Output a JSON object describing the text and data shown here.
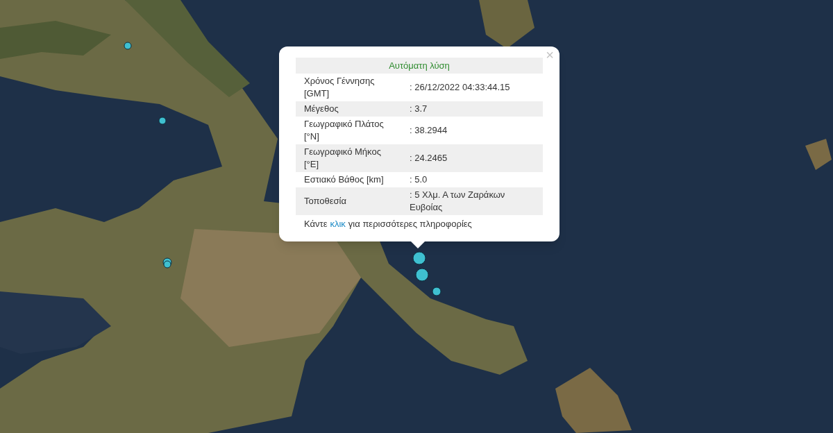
{
  "popup": {
    "title": "Αυτόματη λύση",
    "close": "×",
    "rows": [
      {
        "label": "Χρόνος Γέννησης [GMT]",
        "value": ": 26/12/2022 04:33:44.15"
      },
      {
        "label": "Μέγεθος",
        "value": ": 3.7"
      },
      {
        "label": "Γεωγραφικό Πλάτος [°N]",
        "value": ": 38.2944"
      },
      {
        "label": "Γεωγραφικό Μήκος [°E]",
        "value": ": 24.2465"
      },
      {
        "label": "Εστιακό Βάθος [km]",
        "value": ": 5.0"
      },
      {
        "label": "Τοποθεσία",
        "value": ": 5 Χλμ. Α των Ζαράκων Ευβοίας"
      }
    ],
    "footer": {
      "before": "Κάντε",
      "link": "κλικ",
      "after": "για περισσότερες πληροφορίες"
    }
  }
}
